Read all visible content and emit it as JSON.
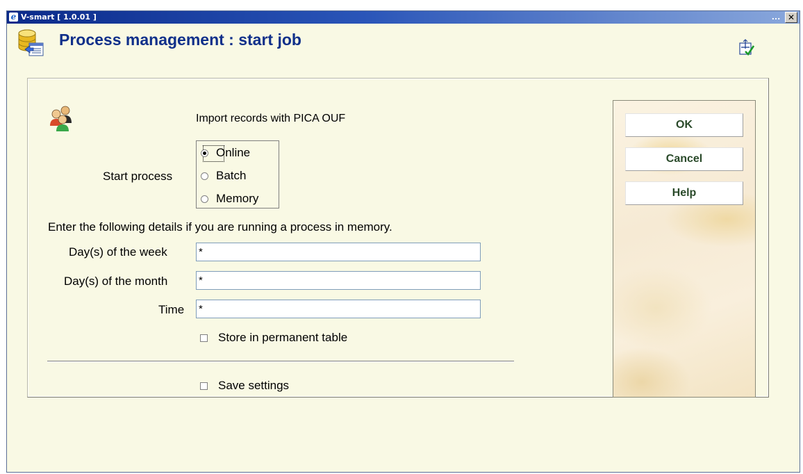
{
  "window": {
    "title": "V-smart [ 1.0.01 ]",
    "minimize_glyph": "...",
    "close_glyph": "✕"
  },
  "header": {
    "title": "Process management : start job",
    "icon": "database-import-icon",
    "right_icon": "select-check-icon"
  },
  "form": {
    "job_icon": "users-group-icon",
    "job_title": "Import records with PICA OUF",
    "start_process_label": "Start process",
    "start_process_options": [
      {
        "label": "Online",
        "selected": true
      },
      {
        "label": "Batch",
        "selected": false
      },
      {
        "label": "Memory",
        "selected": false
      }
    ],
    "memory_note": "Enter the following details if you are running a process in memory.",
    "days_of_week_label": "Day(s) of the week",
    "days_of_week_value": "*",
    "days_of_month_label": "Day(s) of the month",
    "days_of_month_value": "*",
    "time_label": "Time",
    "time_value": "*",
    "store_permanent_label": "Store in permanent table",
    "store_permanent_checked": false,
    "save_settings_label": "Save settings",
    "save_settings_checked": false
  },
  "buttons": {
    "ok": "OK",
    "cancel": "Cancel",
    "help": "Help"
  },
  "colors": {
    "title_bar": "#0a2a8a",
    "page_title": "#10308a",
    "window_bg": "#f9f9e4",
    "button_text": "#2a4a2a"
  }
}
